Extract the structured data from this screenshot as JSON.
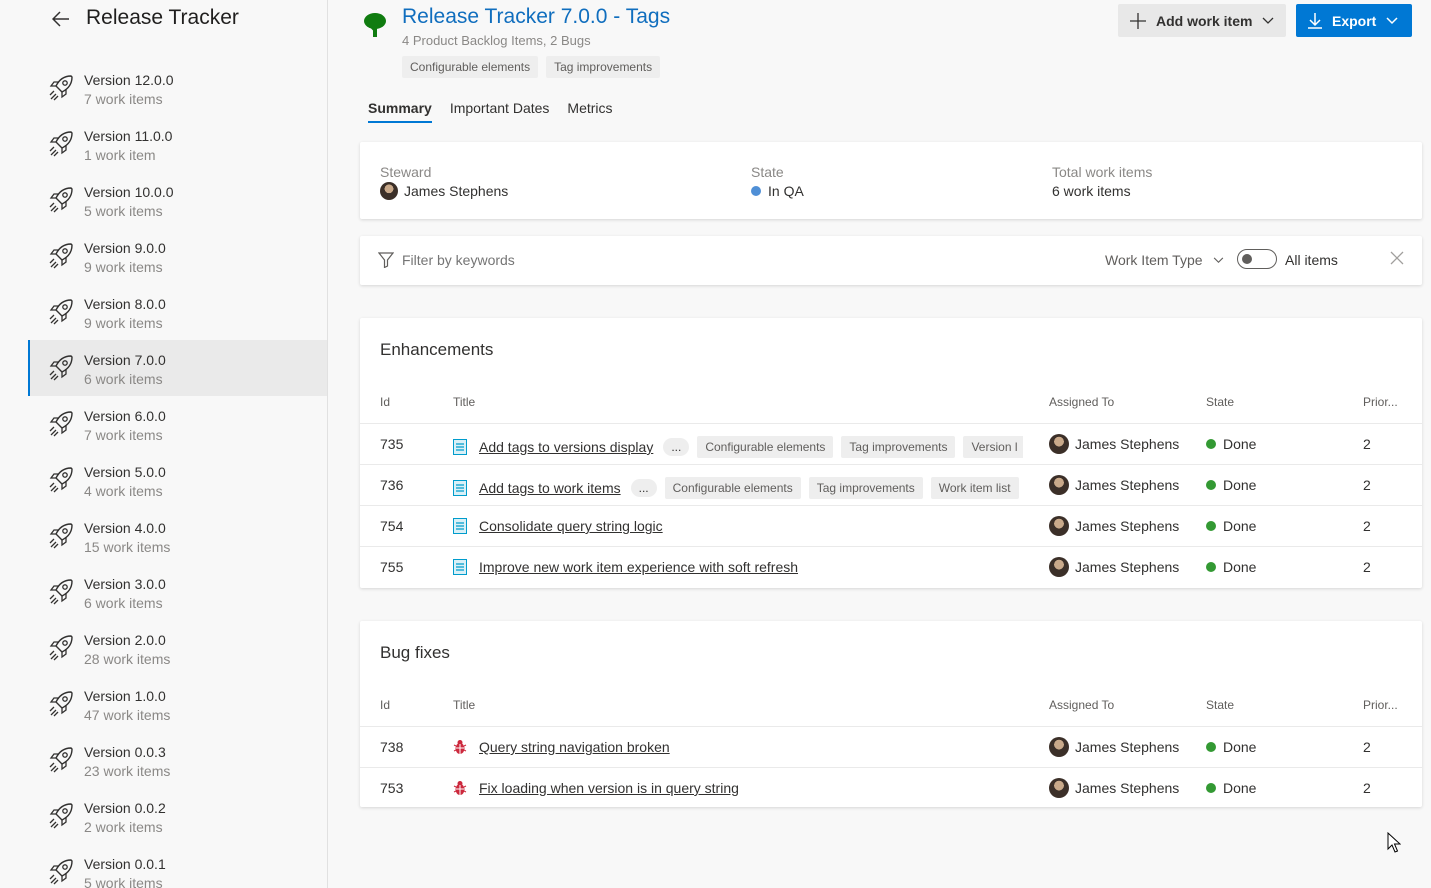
{
  "sidebar": {
    "title": "Release Tracker",
    "items": [
      {
        "name": "Version 12.0.0",
        "count": "7 work items"
      },
      {
        "name": "Version 11.0.0",
        "count": "1 work item"
      },
      {
        "name": "Version 10.0.0",
        "count": "5 work items"
      },
      {
        "name": "Version 9.0.0",
        "count": "9 work items"
      },
      {
        "name": "Version 8.0.0",
        "count": "9 work items"
      },
      {
        "name": "Version 7.0.0",
        "count": "6 work items",
        "selected": true
      },
      {
        "name": "Version 6.0.0",
        "count": "7 work items"
      },
      {
        "name": "Version 5.0.0",
        "count": "4 work items"
      },
      {
        "name": "Version 4.0.0",
        "count": "15 work items"
      },
      {
        "name": "Version 3.0.0",
        "count": "6 work items"
      },
      {
        "name": "Version 2.0.0",
        "count": "28 work items"
      },
      {
        "name": "Version 1.0.0",
        "count": "47 work items"
      },
      {
        "name": "Version 0.0.3",
        "count": "23 work items"
      },
      {
        "name": "Version 0.0.2",
        "count": "2 work items"
      },
      {
        "name": "Version 0.0.1",
        "count": "5 work items"
      }
    ]
  },
  "header": {
    "title": "Release Tracker 7.0.0 - Tags",
    "subtitle": "4 Product Backlog Items, 2 Bugs",
    "tags": [
      "Configurable elements",
      "Tag improvements"
    ],
    "add_label": "Add work item",
    "export_label": "Export"
  },
  "tabs": [
    "Summary",
    "Important Dates",
    "Metrics"
  ],
  "summary": {
    "steward_label": "Steward",
    "steward": "James Stephens",
    "state_label": "State",
    "state": "In QA",
    "state_color": "#4f8fd6",
    "total_label": "Total work items",
    "total": "6 work items"
  },
  "filter": {
    "placeholder": "Filter by keywords",
    "type_label": "Work Item Type",
    "toggle_label": "All items"
  },
  "columns": {
    "id": "Id",
    "title": "Title",
    "assigned": "Assigned To",
    "state": "State",
    "priority": "Prior..."
  },
  "enhancements": {
    "title": "Enhancements",
    "rows": [
      {
        "id": "735",
        "title": "Add tags to versions display",
        "more": "...",
        "tags": [
          "Configurable elements",
          "Tag improvements",
          "Version l"
        ],
        "assigned": "James Stephens",
        "state": "Done",
        "priority": "2"
      },
      {
        "id": "736",
        "title": "Add tags to work items",
        "more": "...",
        "tags": [
          "Configurable elements",
          "Tag improvements",
          "Work item list"
        ],
        "assigned": "James Stephens",
        "state": "Done",
        "priority": "2"
      },
      {
        "id": "754",
        "title": "Consolidate query string logic",
        "assigned": "James Stephens",
        "state": "Done",
        "priority": "2"
      },
      {
        "id": "755",
        "title": "Improve new work item experience with soft refresh",
        "assigned": "James Stephens",
        "state": "Done",
        "priority": "2"
      }
    ]
  },
  "bugs": {
    "title": "Bug fixes",
    "rows": [
      {
        "id": "738",
        "title": "Query string navigation broken",
        "assigned": "James Stephens",
        "state": "Done",
        "priority": "2"
      },
      {
        "id": "753",
        "title": "Fix loading when version is in query string",
        "assigned": "James Stephens",
        "state": "Done",
        "priority": "2"
      }
    ]
  },
  "colors": {
    "accent": "#0078d4",
    "done": "#339933",
    "pbi": "#009ccc",
    "bug": "#cc293d",
    "tree": "#107c10"
  }
}
